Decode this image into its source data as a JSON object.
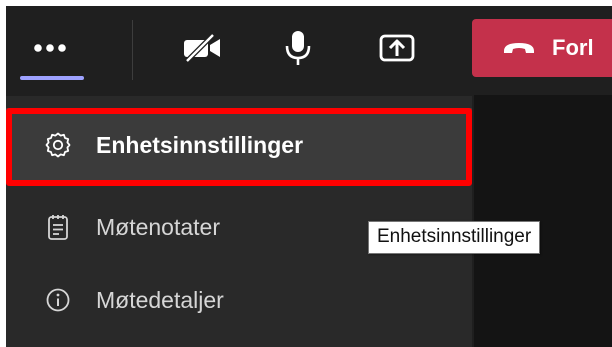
{
  "toolbar": {
    "more_icon": "more-horizontal-icon",
    "camera_icon": "camera-off-icon",
    "mic_icon": "microphone-icon",
    "share_icon": "share-screen-icon",
    "leave_icon": "hang-up-phone-icon",
    "leave_label": "Forl",
    "leave_color": "#c4314b",
    "active_indicator_color": "#9ea2ff"
  },
  "menu": {
    "items": [
      {
        "label": "Enhetsinnstillinger",
        "icon": "gear-icon",
        "highlighted": true
      },
      {
        "label": "Møtenotater",
        "icon": "notes-icon",
        "highlighted": false
      },
      {
        "label": "Møtedetaljer",
        "icon": "info-icon",
        "highlighted": false
      }
    ]
  },
  "tooltip": {
    "text": "Enhetsinnstillinger"
  },
  "highlight_color": "#ff0000"
}
